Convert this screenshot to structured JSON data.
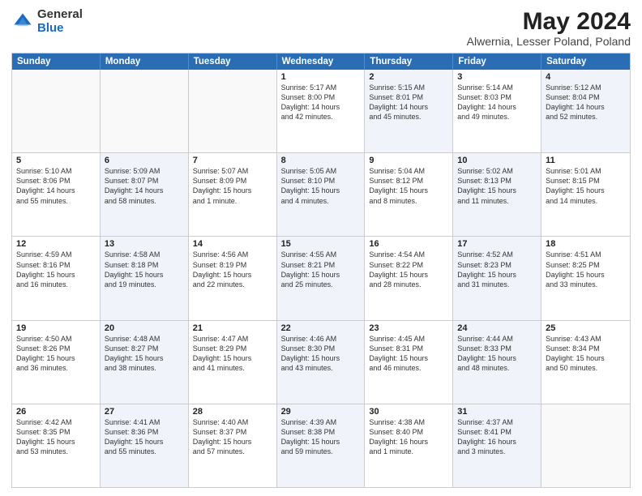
{
  "header": {
    "logo_general": "General",
    "logo_blue": "Blue",
    "main_title": "May 2024",
    "subtitle": "Alwernia, Lesser Poland, Poland"
  },
  "days_of_week": [
    "Sunday",
    "Monday",
    "Tuesday",
    "Wednesday",
    "Thursday",
    "Friday",
    "Saturday"
  ],
  "weeks": [
    [
      {
        "day": "",
        "lines": [],
        "empty": true,
        "shaded": false
      },
      {
        "day": "",
        "lines": [],
        "empty": true,
        "shaded": false
      },
      {
        "day": "",
        "lines": [],
        "empty": true,
        "shaded": false
      },
      {
        "day": "1",
        "lines": [
          "Sunrise: 5:17 AM",
          "Sunset: 8:00 PM",
          "Daylight: 14 hours",
          "and 42 minutes."
        ],
        "empty": false,
        "shaded": false
      },
      {
        "day": "2",
        "lines": [
          "Sunrise: 5:15 AM",
          "Sunset: 8:01 PM",
          "Daylight: 14 hours",
          "and 45 minutes."
        ],
        "empty": false,
        "shaded": true
      },
      {
        "day": "3",
        "lines": [
          "Sunrise: 5:14 AM",
          "Sunset: 8:03 PM",
          "Daylight: 14 hours",
          "and 49 minutes."
        ],
        "empty": false,
        "shaded": false
      },
      {
        "day": "4",
        "lines": [
          "Sunrise: 5:12 AM",
          "Sunset: 8:04 PM",
          "Daylight: 14 hours",
          "and 52 minutes."
        ],
        "empty": false,
        "shaded": true
      }
    ],
    [
      {
        "day": "5",
        "lines": [
          "Sunrise: 5:10 AM",
          "Sunset: 8:06 PM",
          "Daylight: 14 hours",
          "and 55 minutes."
        ],
        "empty": false,
        "shaded": false
      },
      {
        "day": "6",
        "lines": [
          "Sunrise: 5:09 AM",
          "Sunset: 8:07 PM",
          "Daylight: 14 hours",
          "and 58 minutes."
        ],
        "empty": false,
        "shaded": true
      },
      {
        "day": "7",
        "lines": [
          "Sunrise: 5:07 AM",
          "Sunset: 8:09 PM",
          "Daylight: 15 hours",
          "and 1 minute."
        ],
        "empty": false,
        "shaded": false
      },
      {
        "day": "8",
        "lines": [
          "Sunrise: 5:05 AM",
          "Sunset: 8:10 PM",
          "Daylight: 15 hours",
          "and 4 minutes."
        ],
        "empty": false,
        "shaded": true
      },
      {
        "day": "9",
        "lines": [
          "Sunrise: 5:04 AM",
          "Sunset: 8:12 PM",
          "Daylight: 15 hours",
          "and 8 minutes."
        ],
        "empty": false,
        "shaded": false
      },
      {
        "day": "10",
        "lines": [
          "Sunrise: 5:02 AM",
          "Sunset: 8:13 PM",
          "Daylight: 15 hours",
          "and 11 minutes."
        ],
        "empty": false,
        "shaded": true
      },
      {
        "day": "11",
        "lines": [
          "Sunrise: 5:01 AM",
          "Sunset: 8:15 PM",
          "Daylight: 15 hours",
          "and 14 minutes."
        ],
        "empty": false,
        "shaded": false
      }
    ],
    [
      {
        "day": "12",
        "lines": [
          "Sunrise: 4:59 AM",
          "Sunset: 8:16 PM",
          "Daylight: 15 hours",
          "and 16 minutes."
        ],
        "empty": false,
        "shaded": false
      },
      {
        "day": "13",
        "lines": [
          "Sunrise: 4:58 AM",
          "Sunset: 8:18 PM",
          "Daylight: 15 hours",
          "and 19 minutes."
        ],
        "empty": false,
        "shaded": true
      },
      {
        "day": "14",
        "lines": [
          "Sunrise: 4:56 AM",
          "Sunset: 8:19 PM",
          "Daylight: 15 hours",
          "and 22 minutes."
        ],
        "empty": false,
        "shaded": false
      },
      {
        "day": "15",
        "lines": [
          "Sunrise: 4:55 AM",
          "Sunset: 8:21 PM",
          "Daylight: 15 hours",
          "and 25 minutes."
        ],
        "empty": false,
        "shaded": true
      },
      {
        "day": "16",
        "lines": [
          "Sunrise: 4:54 AM",
          "Sunset: 8:22 PM",
          "Daylight: 15 hours",
          "and 28 minutes."
        ],
        "empty": false,
        "shaded": false
      },
      {
        "day": "17",
        "lines": [
          "Sunrise: 4:52 AM",
          "Sunset: 8:23 PM",
          "Daylight: 15 hours",
          "and 31 minutes."
        ],
        "empty": false,
        "shaded": true
      },
      {
        "day": "18",
        "lines": [
          "Sunrise: 4:51 AM",
          "Sunset: 8:25 PM",
          "Daylight: 15 hours",
          "and 33 minutes."
        ],
        "empty": false,
        "shaded": false
      }
    ],
    [
      {
        "day": "19",
        "lines": [
          "Sunrise: 4:50 AM",
          "Sunset: 8:26 PM",
          "Daylight: 15 hours",
          "and 36 minutes."
        ],
        "empty": false,
        "shaded": false
      },
      {
        "day": "20",
        "lines": [
          "Sunrise: 4:48 AM",
          "Sunset: 8:27 PM",
          "Daylight: 15 hours",
          "and 38 minutes."
        ],
        "empty": false,
        "shaded": true
      },
      {
        "day": "21",
        "lines": [
          "Sunrise: 4:47 AM",
          "Sunset: 8:29 PM",
          "Daylight: 15 hours",
          "and 41 minutes."
        ],
        "empty": false,
        "shaded": false
      },
      {
        "day": "22",
        "lines": [
          "Sunrise: 4:46 AM",
          "Sunset: 8:30 PM",
          "Daylight: 15 hours",
          "and 43 minutes."
        ],
        "empty": false,
        "shaded": true
      },
      {
        "day": "23",
        "lines": [
          "Sunrise: 4:45 AM",
          "Sunset: 8:31 PM",
          "Daylight: 15 hours",
          "and 46 minutes."
        ],
        "empty": false,
        "shaded": false
      },
      {
        "day": "24",
        "lines": [
          "Sunrise: 4:44 AM",
          "Sunset: 8:33 PM",
          "Daylight: 15 hours",
          "and 48 minutes."
        ],
        "empty": false,
        "shaded": true
      },
      {
        "day": "25",
        "lines": [
          "Sunrise: 4:43 AM",
          "Sunset: 8:34 PM",
          "Daylight: 15 hours",
          "and 50 minutes."
        ],
        "empty": false,
        "shaded": false
      }
    ],
    [
      {
        "day": "26",
        "lines": [
          "Sunrise: 4:42 AM",
          "Sunset: 8:35 PM",
          "Daylight: 15 hours",
          "and 53 minutes."
        ],
        "empty": false,
        "shaded": false
      },
      {
        "day": "27",
        "lines": [
          "Sunrise: 4:41 AM",
          "Sunset: 8:36 PM",
          "Daylight: 15 hours",
          "and 55 minutes."
        ],
        "empty": false,
        "shaded": true
      },
      {
        "day": "28",
        "lines": [
          "Sunrise: 4:40 AM",
          "Sunset: 8:37 PM",
          "Daylight: 15 hours",
          "and 57 minutes."
        ],
        "empty": false,
        "shaded": false
      },
      {
        "day": "29",
        "lines": [
          "Sunrise: 4:39 AM",
          "Sunset: 8:38 PM",
          "Daylight: 15 hours",
          "and 59 minutes."
        ],
        "empty": false,
        "shaded": true
      },
      {
        "day": "30",
        "lines": [
          "Sunrise: 4:38 AM",
          "Sunset: 8:40 PM",
          "Daylight: 16 hours",
          "and 1 minute."
        ],
        "empty": false,
        "shaded": false
      },
      {
        "day": "31",
        "lines": [
          "Sunrise: 4:37 AM",
          "Sunset: 8:41 PM",
          "Daylight: 16 hours",
          "and 3 minutes."
        ],
        "empty": false,
        "shaded": true
      },
      {
        "day": "",
        "lines": [],
        "empty": true,
        "shaded": false
      }
    ]
  ]
}
